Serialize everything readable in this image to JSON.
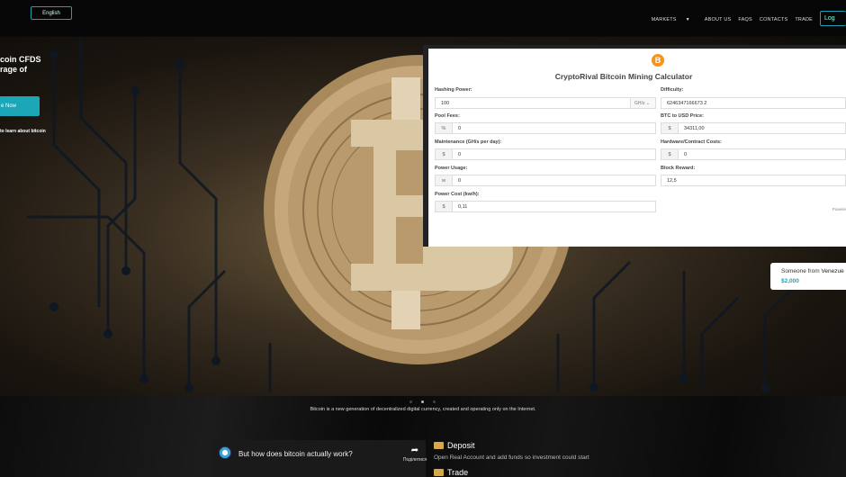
{
  "topbar": {
    "language": "English",
    "nav": [
      "MARKETS",
      "ABOUT US",
      "FAQS",
      "CONTACTS",
      "TRADE"
    ],
    "login_label": "Log"
  },
  "hero": {
    "headline_line1": "coin CFDS",
    "headline_line2": "rage of",
    "cta_label": "e Now",
    "learn_link": "to learn about bitcoin"
  },
  "calculator": {
    "title": "CryptoRival Bitcoin Mining Calculator",
    "coin_symbol": "B",
    "fields": {
      "hashing_power": {
        "label": "Hashing Power:",
        "value": "100",
        "unit": "GH/s"
      },
      "difficulty": {
        "label": "Difficulty:",
        "value": "6246347166673 2"
      },
      "pool_fees": {
        "label": "Pool Fees:",
        "addon": "%",
        "value": "0"
      },
      "btc_price": {
        "label": "BTC to USD Price:",
        "addon": "$",
        "value": "34311,00"
      },
      "maintenance": {
        "label": "Maintenance (GH/s per day):",
        "addon": "$",
        "value": "0"
      },
      "hardware": {
        "label": "Hardware/Contract Costs:",
        "addon": "$",
        "value": "0"
      },
      "power_usage": {
        "label": "Power Usage:",
        "addon": "w",
        "value": "0"
      },
      "block_reward": {
        "label": "Block Reward:",
        "value": "12,5"
      },
      "power_cost": {
        "label": "Power Cost (kw/h):",
        "addon": "$",
        "value": "0,11"
      }
    },
    "powered": "Powere"
  },
  "notification": {
    "prefix": "Someone from ",
    "country": "Venezue",
    "amount": "$2,000"
  },
  "bottom": {
    "tagline": "Bitcoin is a new generation of decentralized digital currency, created and operating only on the Internet.",
    "video_title": "But how does bitcoin actually work?",
    "share_label": "Поділитися",
    "step1_title": "Deposit",
    "step1_desc": "Open Real Account and add funds so investment could start",
    "step2_title": "Trade"
  },
  "colors": {
    "accent": "#1ba7b8",
    "bitcoin": "#f7931a",
    "gold": "#d6a84b"
  }
}
